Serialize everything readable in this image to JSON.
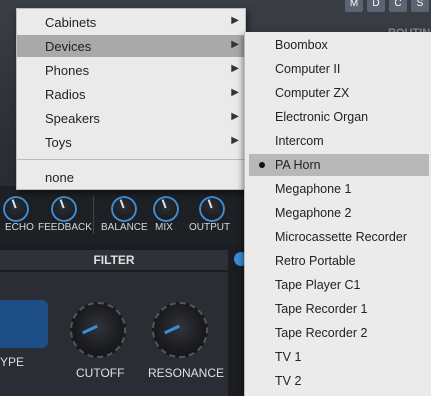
{
  "header": {
    "buttons": [
      "M",
      "D",
      "C",
      "S"
    ],
    "routing_label": "ROUTIN"
  },
  "knobs_row": {
    "labels": [
      "ECHO",
      "FEEDBACK",
      "BALANCE",
      "MIX",
      "OUTPUT"
    ]
  },
  "filter": {
    "title": "FILTER",
    "type_label": "YPE",
    "cutoff_label": "CUTOFF",
    "resonance_label": "RESONANCE"
  },
  "menu_primary": {
    "items": [
      {
        "label": "Cabinets",
        "has_submenu": true
      },
      {
        "label": "Devices",
        "has_submenu": true,
        "highlighted": true
      },
      {
        "label": "Phones",
        "has_submenu": true
      },
      {
        "label": "Radios",
        "has_submenu": true
      },
      {
        "label": "Speakers",
        "has_submenu": true
      },
      {
        "label": "Toys",
        "has_submenu": true
      }
    ],
    "none_label": "none"
  },
  "menu_devices": {
    "items": [
      "Boombox",
      "Computer II",
      "Computer ZX",
      "Electronic Organ",
      "Intercom",
      "PA Horn",
      "Megaphone 1",
      "Megaphone 2",
      "Microcassette Recorder",
      "Retro Portable",
      "Tape Player C1",
      "Tape Recorder 1",
      "Tape Recorder 2",
      "TV 1",
      "TV 2"
    ],
    "selected": "PA Horn"
  },
  "colors": {
    "accent": "#3b8ed6",
    "menu_bg": "#ebebeb",
    "highlight": "#a9a9a9"
  }
}
